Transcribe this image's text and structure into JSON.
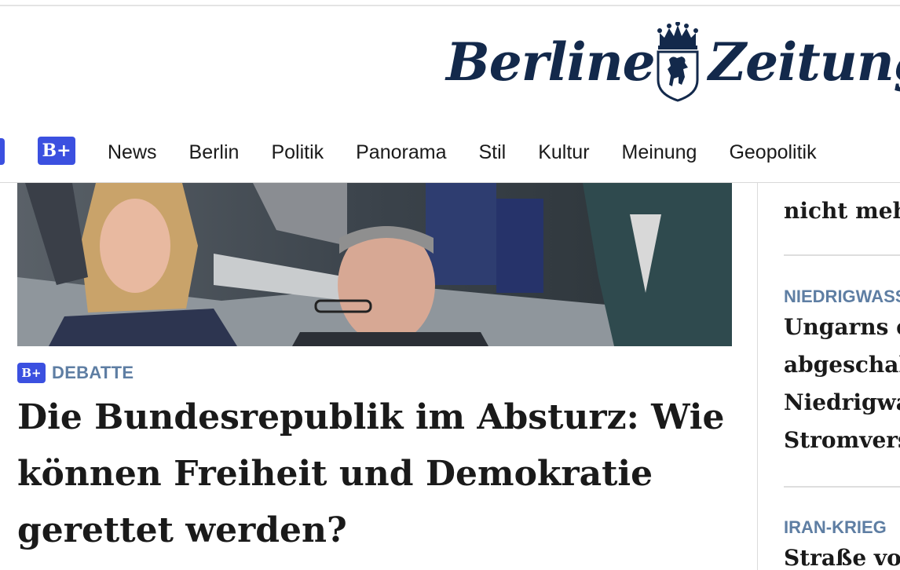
{
  "masthead": {
    "logo_text_1": "Berliner",
    "logo_text_2": "Zeitung"
  },
  "nav": {
    "plus_badge": "B+",
    "items": [
      "News",
      "Berlin",
      "Politik",
      "Panorama",
      "Stil",
      "Kultur",
      "Meinung",
      "Geopolitik"
    ]
  },
  "article": {
    "badge": "B+",
    "kicker": "DEBATTE",
    "headline": "Die Bundesrepublik im Absturz: Wie können Freiheit und Demokratie gerettet werden?"
  },
  "sidebar": {
    "item1_tail": "nicht meh",
    "item2": {
      "kicker": "NIEDRIGWASS",
      "lines": [
        "Ungarns e",
        "abgeschalt",
        "Niedrigwa",
        "Stromvers"
      ]
    },
    "item3": {
      "kicker": "IRAN-KRIEG",
      "line": "Straße vor"
    }
  },
  "colors": {
    "brand_blue": "#3b50e0",
    "navy": "#13294b",
    "kicker": "#5e7ea3"
  }
}
